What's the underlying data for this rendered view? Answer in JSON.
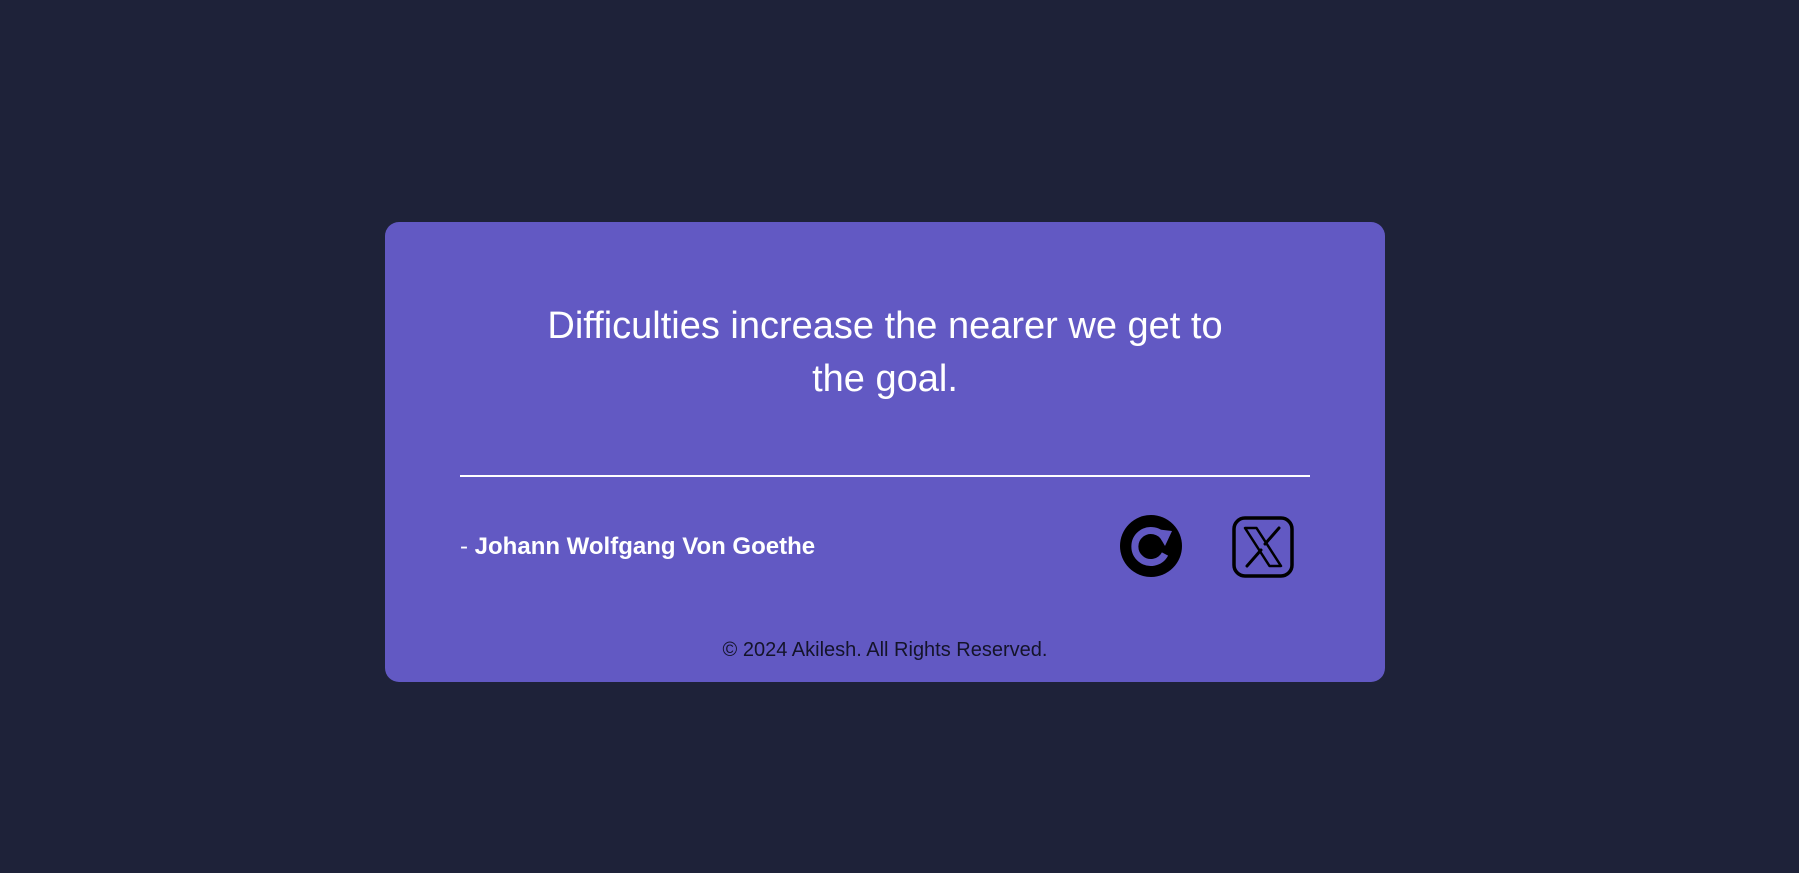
{
  "quote": {
    "text": "Difficulties increase the nearer we get to the goal.",
    "author_prefix": "- ",
    "author": "Johann Wolfgang Von Goethe"
  },
  "actions": {
    "new_quote_icon": "refresh-icon",
    "tweet_icon": "x-twitter-icon"
  },
  "footer": {
    "copyright": "© 2024 Akilesh. All Rights Reserved."
  },
  "colors": {
    "page_background": "#1e2239",
    "card_background": "#6259c3",
    "text_primary": "#ffffff",
    "footer_text": "#14142a",
    "icon": "#000000"
  }
}
